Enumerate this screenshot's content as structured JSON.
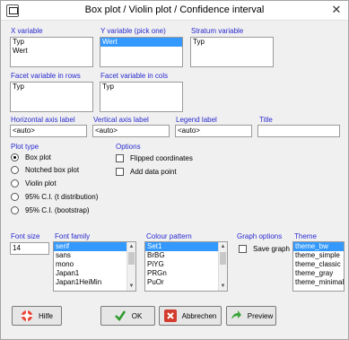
{
  "window": {
    "title": "Box plot / Violin plot / Confidence interval"
  },
  "x_variable": {
    "label": "X variable",
    "items": [
      "Typ",
      "Wert"
    ]
  },
  "y_variable": {
    "label": "Y variable (pick one)",
    "items": [
      "Wert"
    ]
  },
  "stratum_variable": {
    "label": "Stratum variable",
    "items": [
      "Typ"
    ]
  },
  "facet_rows": {
    "label": "Facet variable in rows",
    "items": [
      "Typ"
    ]
  },
  "facet_cols": {
    "label": "Facet variable in cols",
    "items": [
      "Typ"
    ]
  },
  "axis_labels": {
    "horizontal_label": "Horizontal axis label",
    "horizontal_value": "<auto>",
    "vertical_label": "Vertical axis label",
    "vertical_value": "<auto>",
    "legend_label": "Legend label",
    "legend_value": "<auto>",
    "title_label": "Title",
    "title_value": ""
  },
  "plot_type": {
    "label": "Plot type",
    "options": [
      "Box plot",
      "Notched box plot",
      "Violin plot",
      "95% C.I. (t distribution)",
      "95% C.I. (bootstrap)"
    ],
    "selected": 0
  },
  "options": {
    "label": "Options",
    "flipped": "Flipped coordinates",
    "add_point": "Add data point"
  },
  "font_size": {
    "label": "Font size",
    "value": "14"
  },
  "font_family": {
    "label": "Font family",
    "items": [
      "serif",
      "sans",
      "mono",
      "Japan1",
      "Japan1HeiMin"
    ]
  },
  "colour_pattern": {
    "label": "Colour pattern",
    "items": [
      "Set1",
      "BrBG",
      "PiYG",
      "PRGn",
      "PuOr"
    ]
  },
  "graph_options": {
    "label": "Graph options",
    "save_graph": "Save graph"
  },
  "theme": {
    "label": "Theme",
    "items": [
      "theme_bw",
      "theme_simple",
      "theme_classic",
      "theme_gray",
      "theme_minimal"
    ]
  },
  "buttons": {
    "help": "Hilfe",
    "ok": "OK",
    "cancel": "Abbrechen",
    "preview": "Preview"
  }
}
